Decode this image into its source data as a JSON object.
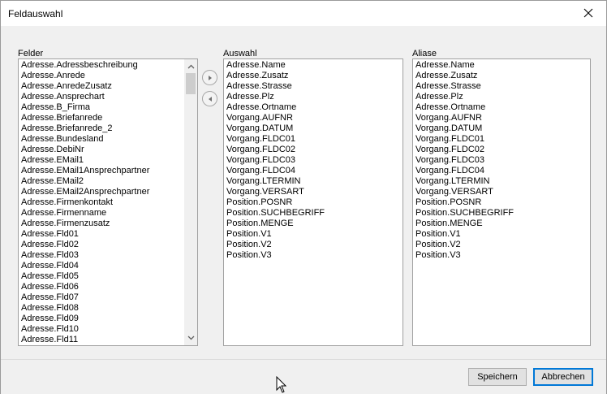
{
  "window": {
    "title": "Feldauswahl"
  },
  "labels": {
    "felder": "Felder",
    "auswahl": "Auswahl",
    "aliase": "Aliase"
  },
  "felder_items": [
    "Adresse.Adressbeschreibung",
    "Adresse.Anrede",
    "Adresse.AnredeZusatz",
    "Adresse.Ansprechart",
    "Adresse.B_Firma",
    "Adresse.Briefanrede",
    "Adresse.Briefanrede_2",
    "Adresse.Bundesland",
    "Adresse.DebiNr",
    "Adresse.EMail1",
    "Adresse.EMail1Ansprechpartner",
    "Adresse.EMail2",
    "Adresse.EMail2Ansprechpartner",
    "Adresse.Firmenkontakt",
    "Adresse.Firmenname",
    "Adresse.Firmenzusatz",
    "Adresse.Fld01",
    "Adresse.Fld02",
    "Adresse.Fld03",
    "Adresse.Fld04",
    "Adresse.Fld05",
    "Adresse.Fld06",
    "Adresse.Fld07",
    "Adresse.Fld08",
    "Adresse.Fld09",
    "Adresse.Fld10",
    "Adresse.Fld11"
  ],
  "auswahl_items": [
    "Adresse.Name",
    "Adresse.Zusatz",
    "Adresse.Strasse",
    "Adresse.Plz",
    "Adresse.Ortname",
    "Vorgang.AUFNR",
    "Vorgang.DATUM",
    "Vorgang.FLDC01",
    "Vorgang.FLDC02",
    "Vorgang.FLDC03",
    "Vorgang.FLDC04",
    "Vorgang.LTERMIN",
    "Vorgang.VERSART",
    "Position.POSNR",
    "Position.SUCHBEGRIFF",
    "Position.MENGE",
    "Position.V1",
    "Position.V2",
    "Position.V3"
  ],
  "aliase_items": [
    "Adresse.Name",
    "Adresse.Zusatz",
    "Adresse.Strasse",
    "Adresse.Plz",
    "Adresse.Ortname",
    "Vorgang.AUFNR",
    "Vorgang.DATUM",
    "Vorgang.FLDC01",
    "Vorgang.FLDC02",
    "Vorgang.FLDC03",
    "Vorgang.FLDC04",
    "Vorgang.LTERMIN",
    "Vorgang.VERSART",
    "Position.POSNR",
    "Position.SUCHBEGRIFF",
    "Position.MENGE",
    "Position.V1",
    "Position.V2",
    "Position.V3"
  ],
  "buttons": {
    "save": "Speichern",
    "cancel": "Abbrechen"
  },
  "icons": {
    "close": "close-icon",
    "add": "arrow-right-circle-icon",
    "remove": "arrow-left-circle-icon",
    "scroll_up": "chevron-up-icon",
    "scroll_down": "chevron-down-icon",
    "cursor": "mouse-pointer-icon"
  },
  "colors": {
    "accent": "#0078d7",
    "panel": "#f0f0f0",
    "list_border": "#a0a0a0"
  }
}
